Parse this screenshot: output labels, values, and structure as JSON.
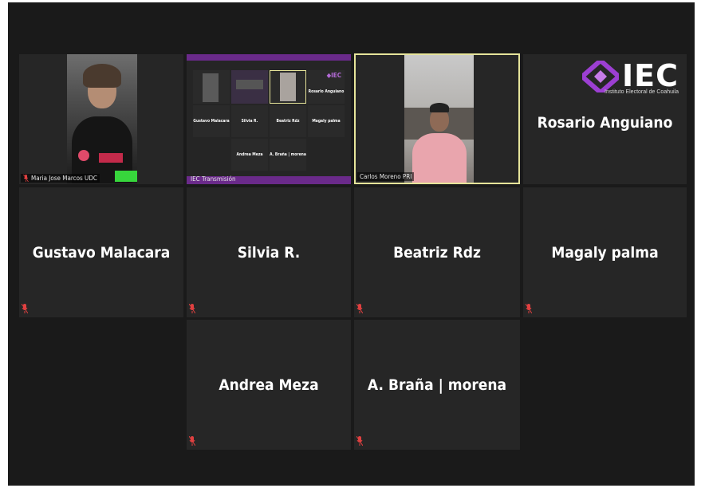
{
  "participants": [
    {
      "name": "Maria Jose Marcos UDC"
    },
    {
      "name": "IEC Transmisión"
    },
    {
      "name": "Carlos Moreno PRI"
    },
    {
      "name": "Rosario Anguiano"
    },
    {
      "name": "Gustavo Malacara"
    },
    {
      "name": "Silvia R."
    },
    {
      "name": "Beatriz Rdz"
    },
    {
      "name": "Magaly palma"
    },
    {
      "name": "Andrea Meza"
    },
    {
      "name": "A. Braña | morena"
    }
  ],
  "stream_preview": {
    "tiles": [
      {
        "name": "Rosario Anguiano"
      },
      {
        "name": "Gustavo Malacara"
      },
      {
        "name": "Silvia R."
      },
      {
        "name": "Beatriz Rdz"
      },
      {
        "name": "Magaly palma"
      },
      {
        "name": "Andrea Meza"
      },
      {
        "name": "A. Braña | morena"
      }
    ]
  },
  "logo": {
    "text": "IEC",
    "subtitle": "Instituto Electoral de Coahuila"
  },
  "colors": {
    "stage_bg": "#1a1a1a",
    "tile_bg": "#262626",
    "active_speaker_border": "#e6e49a",
    "stream_accent": "#6a2a8a",
    "mic_muted": "#e04040",
    "logo_purple": "#9c3fd2"
  }
}
